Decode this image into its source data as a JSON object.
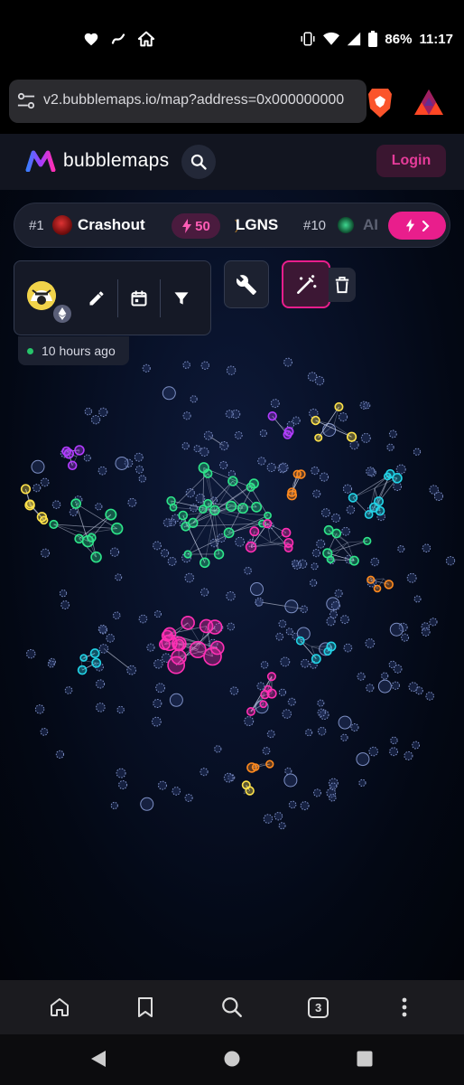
{
  "status_bar": {
    "battery": "86%",
    "time": "11:17"
  },
  "browser": {
    "url": "v2.bubblemaps.io/map?address=0x000000000",
    "tab_count": "3"
  },
  "app": {
    "brand": "bubblemaps",
    "login_label": "Login"
  },
  "trending": {
    "items": [
      {
        "rank": "#1",
        "name": "Crashout",
        "boost": "50"
      },
      {
        "rank": "",
        "name": "LGNS"
      },
      {
        "rank": "#10",
        "name": "AI"
      }
    ]
  },
  "token_panel": {
    "chain_icon": "ethereum-icon",
    "last_update": "10 hours ago"
  },
  "colors": {
    "accent": "#e91e8c",
    "green": "#2ee58a",
    "magenta": "#ff2fb4",
    "cyan": "#22d3e6",
    "orange": "#ff8a1e",
    "yellow": "#ffe34a",
    "purple": "#b33cff"
  }
}
